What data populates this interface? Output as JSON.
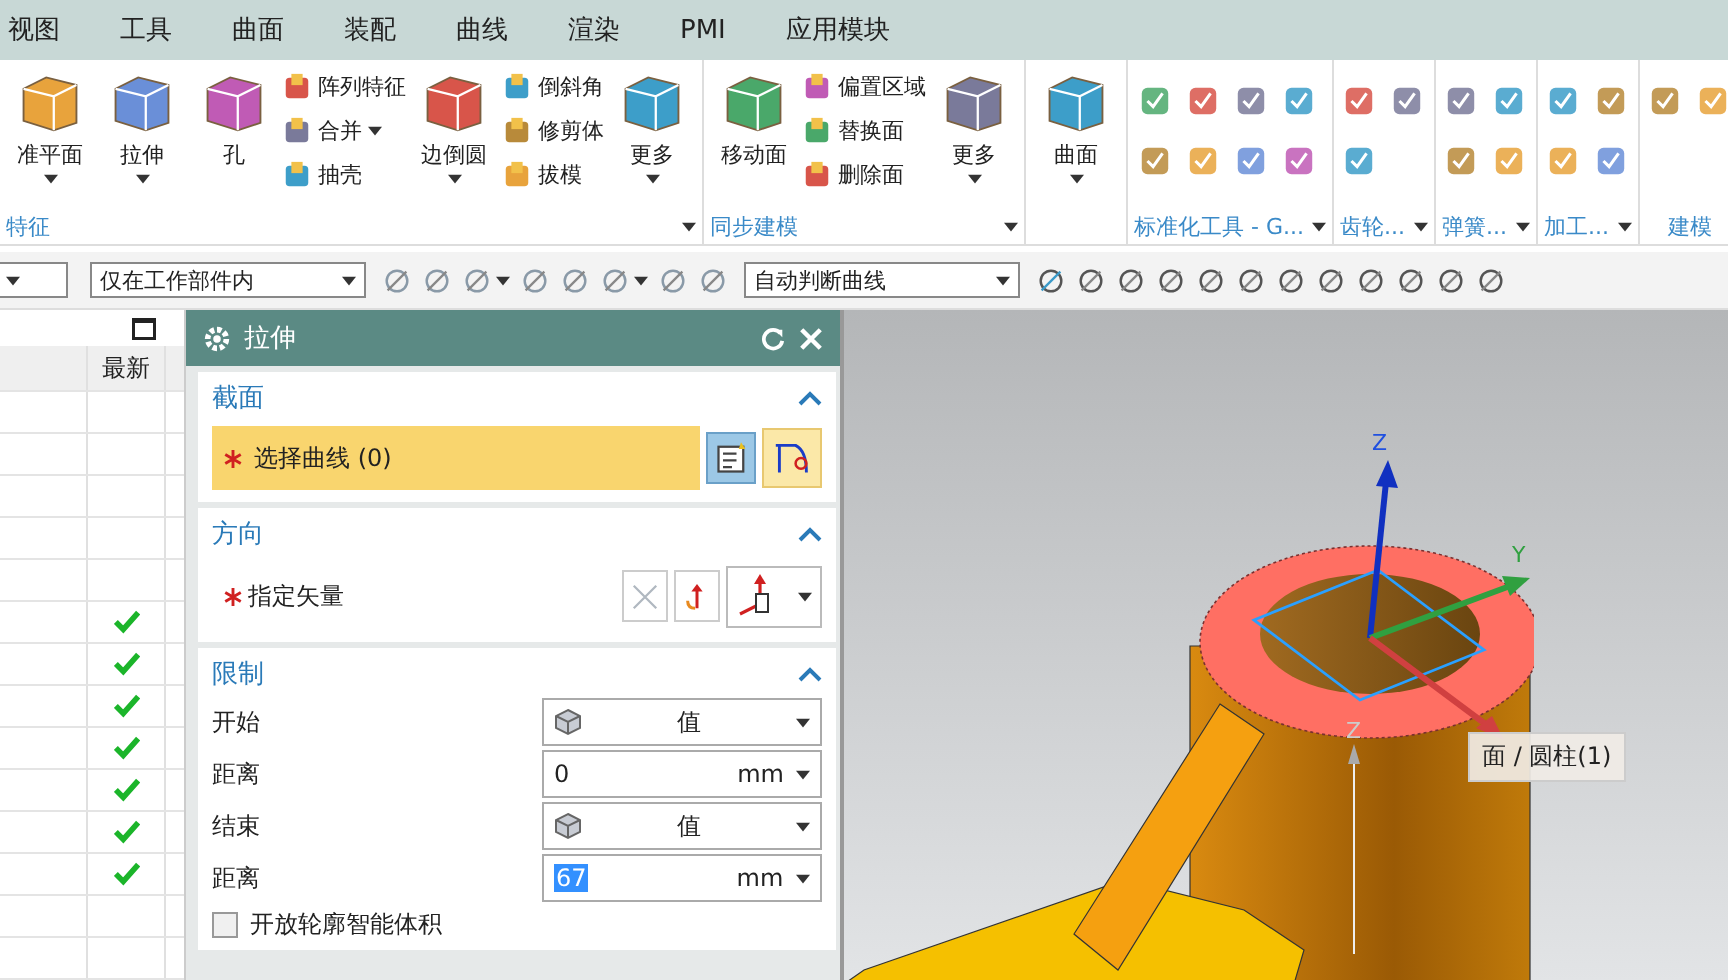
{
  "menu_tabs": [
    {
      "label": "视图",
      "selected": false
    },
    {
      "label": "工具",
      "selected": false
    },
    {
      "label": "曲面",
      "selected": false
    },
    {
      "label": "装配",
      "selected": false
    },
    {
      "label": "曲线",
      "selected": false
    },
    {
      "label": "渲染",
      "selected": false
    },
    {
      "label": "PMI",
      "selected": false
    },
    {
      "label": "应用模块",
      "selected": false
    }
  ],
  "ribbon": {
    "groups": [
      {
        "label": "特征",
        "menu": true,
        "columns": [
          {
            "kind": "large",
            "label": "准平面",
            "caret": true
          },
          {
            "kind": "large",
            "label": "拉伸",
            "caret": true
          },
          {
            "kind": "large",
            "label": "孔"
          },
          {
            "kind": "stack",
            "items": [
              {
                "label": "阵列特征"
              },
              {
                "label": "合并",
                "caret": true
              },
              {
                "label": "抽壳"
              }
            ]
          },
          {
            "kind": "large",
            "label": "边倒圆",
            "caret": true
          },
          {
            "kind": "stack",
            "items": [
              {
                "label": "倒斜角"
              },
              {
                "label": "修剪体"
              },
              {
                "label": "拔模"
              }
            ]
          },
          {
            "kind": "large",
            "label": "更多",
            "caret": true
          }
        ]
      },
      {
        "label": "同步建模",
        "menu": true,
        "columns": [
          {
            "kind": "large",
            "label": "移动面"
          },
          {
            "kind": "stack",
            "items": [
              {
                "label": "偏置区域"
              },
              {
                "label": "替换面"
              },
              {
                "label": "删除面"
              }
            ]
          },
          {
            "kind": "large",
            "label": "更多",
            "caret": true
          }
        ]
      },
      {
        "columns": [
          {
            "kind": "large",
            "label": "曲面",
            "caret": true
          }
        ]
      },
      {
        "label": "标准化工具 - G...",
        "menu": true,
        "columns": [
          {
            "kind": "tools",
            "items": [
              {
                "kind": "tool"
              },
              {
                "kind": "tool"
              },
              {
                "kind": "tool"
              },
              {
                "kind": "tool"
              },
              {
                "kind": "tool"
              },
              {
                "kind": "tool"
              },
              {
                "kind": "tool"
              },
              {
                "kind": "tool"
              }
            ]
          }
        ]
      },
      {
        "label": "齿轮...",
        "menu": true,
        "columns": [
          {
            "kind": "tools",
            "items": [
              {
                "kind": "tool"
              },
              {
                "kind": "tool"
              },
              {
                "kind": "tool"
              }
            ]
          }
        ]
      },
      {
        "label": "弹簧...",
        "menu": true,
        "columns": [
          {
            "kind": "tools",
            "items": [
              {
                "kind": "tool"
              },
              {
                "kind": "tool"
              },
              {
                "kind": "tool"
              },
              {
                "kind": "tool"
              }
            ]
          }
        ]
      },
      {
        "label": "加工...",
        "menu": true,
        "columns": [
          {
            "kind": "tools",
            "items": [
              {
                "kind": "tool"
              },
              {
                "kind": "tool"
              },
              {
                "kind": "tool"
              },
              {
                "kind": "tool"
              }
            ]
          }
        ]
      },
      {
        "label": "建模",
        "columns": [
          {
            "kind": "tools",
            "items": [
              {
                "kind": "tool"
              },
              {
                "kind": "tool"
              }
            ]
          }
        ]
      }
    ]
  },
  "toolbar": [
    {
      "kind": "dropdown"
    },
    {
      "kind": "dropdown",
      "value": "仅在工作部件内"
    },
    {
      "kind": "tool"
    },
    {
      "kind": "tool"
    },
    {
      "kind": "tool",
      "caret": true
    },
    {
      "kind": "tool"
    },
    {
      "kind": "tool"
    },
    {
      "kind": "tool",
      "caret": true
    },
    {
      "kind": "tool"
    },
    {
      "kind": "tool"
    },
    {
      "kind": "dropdown",
      "value": "自动判断曲线"
    },
    {
      "kind": "tool"
    },
    {
      "kind": "tool"
    },
    {
      "kind": "tool"
    },
    {
      "kind": "tool"
    },
    {
      "kind": "tool"
    },
    {
      "kind": "tool"
    },
    {
      "kind": "tool"
    },
    {
      "kind": "tool"
    },
    {
      "kind": "tool"
    },
    {
      "kind": "tool"
    },
    {
      "kind": "tool"
    },
    {
      "kind": "tool"
    }
  ],
  "navigator": {
    "column": "最新",
    "rows": [
      {
        "latest": false
      },
      {
        "latest": false
      },
      {
        "latest": false
      },
      {
        "latest": false
      },
      {
        "latest": false
      },
      {
        "latest": true
      },
      {
        "latest": true
      },
      {
        "latest": true
      },
      {
        "latest": true
      },
      {
        "latest": true
      },
      {
        "latest": true
      },
      {
        "latest": true
      },
      {
        "latest": false
      },
      {
        "latest": false
      }
    ]
  },
  "dialog": {
    "title": "拉伸",
    "sections": [
      {
        "title": "截面",
        "expanded": true,
        "rows": [
          {
            "kind": "select",
            "label": "选择曲线 (0)",
            "required": true,
            "selected": true
          }
        ]
      },
      {
        "title": "方向",
        "expanded": true,
        "rows": [
          {
            "kind": "vector",
            "label": "指定矢量",
            "required": true
          }
        ]
      },
      {
        "title": "限制",
        "expanded": true,
        "rows": [
          {
            "kind": "dropdown",
            "label": "开始",
            "value": "值"
          },
          {
            "kind": "number",
            "label": "距离",
            "value": "0",
            "unit": "mm",
            "selected": false
          },
          {
            "kind": "dropdown",
            "label": "结束",
            "value": "值"
          },
          {
            "kind": "number",
            "label": "距离",
            "value": "67",
            "unit": "mm",
            "selected": true
          },
          {
            "kind": "checkbox",
            "label": "开放轮廓智能体积",
            "checked": false
          }
        ]
      }
    ]
  },
  "viewport": {
    "triad": {
      "z": "Z",
      "y": "Y"
    },
    "secondary_axis_label": "Z",
    "tooltip": "面 / 圆柱(1)"
  }
}
